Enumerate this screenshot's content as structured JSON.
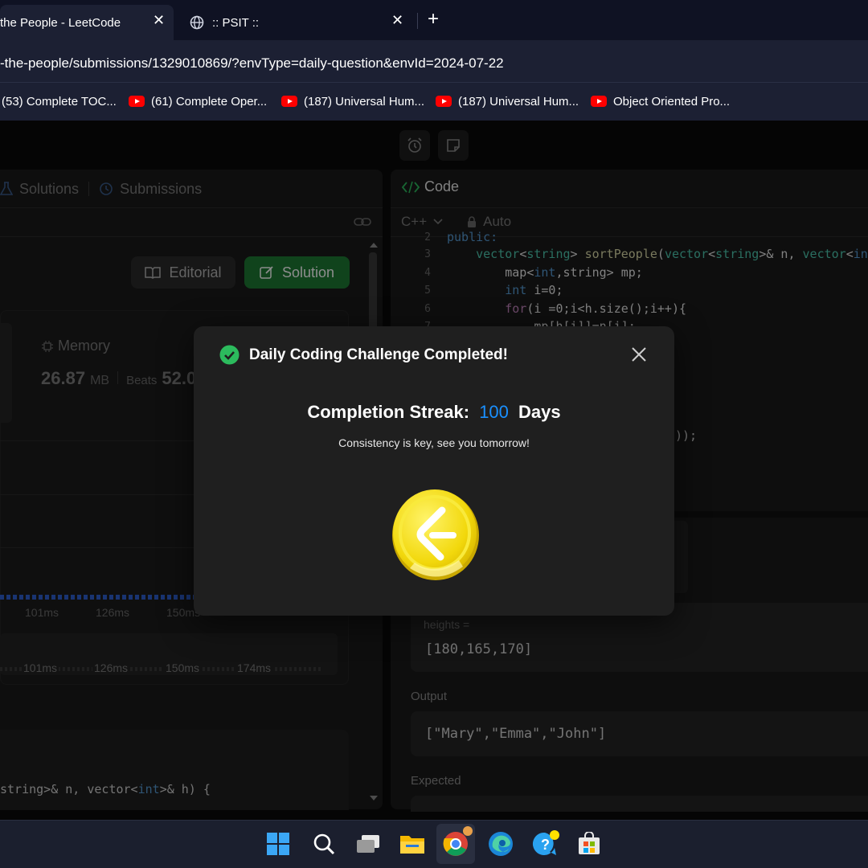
{
  "browser": {
    "tabs": [
      {
        "title": "the People - LeetCode",
        "active": true
      },
      {
        "title": ":: PSIT ::",
        "active": false
      }
    ],
    "new_tab_label": "+",
    "close_glyph": "✕",
    "url": "-the-people/submissions/1329010869/?envType=daily-question&envId=2024-07-22",
    "bookmarks": [
      {
        "label": "(53) Complete TOC..."
      },
      {
        "label": "(61) Complete Oper..."
      },
      {
        "label": "(187) Universal Hum..."
      },
      {
        "label": "(187) Universal Hum..."
      },
      {
        "label": "Object Oriented Pro..."
      }
    ]
  },
  "left_panel": {
    "tabs": [
      {
        "label": "Solutions"
      },
      {
        "label": "Submissions"
      }
    ],
    "editorial_label": "Editorial",
    "solution_label": "Solution",
    "memory": {
      "label": "Memory",
      "value": "26.87",
      "unit": "MB",
      "beats_label": "Beats",
      "beats_value": "52.0"
    },
    "runtime_axis": [
      "101ms",
      "126ms",
      "150ms"
    ],
    "runtime_axis_2": [
      "101ms",
      "126ms",
      "150ms",
      "174ms"
    ],
    "code_snippet": {
      "prefix": "string>& n, vector<",
      "kw": "int",
      "suffix": ">& h) {"
    }
  },
  "right_panel": {
    "title": "Code",
    "language": "C++",
    "auto_label": "Auto",
    "code_lines": [
      {
        "num": "2",
        "text": "public:"
      },
      {
        "num": "3",
        "text": "    vector<string> sortPeople(vector<string>& n, vector<int"
      },
      {
        "num": "4",
        "text": "        map<int,string> mp;"
      },
      {
        "num": "5",
        "text": "        int i=0;"
      },
      {
        "num": "6",
        "text": "        for(i =0;i<h.size();i++){"
      },
      {
        "num": "7",
        "text": "            mp[h[i]]=n[i];"
      }
    ],
    "code_tail": "));",
    "heights_label": "heights =",
    "heights_value": "[180,165,170]",
    "output_label": "Output",
    "output_value": "[\"Mary\",\"Emma\",\"John\"]",
    "expected_label": "Expected"
  },
  "modal": {
    "title": "Daily Coding Challenge Completed!",
    "streak_label": "Completion Streak:",
    "streak_value": "100",
    "streak_unit": "Days",
    "message": "Consistency is key, see you tomorrow!",
    "close_glyph": "✕",
    "colors": {
      "accent": "#1a90ff",
      "success": "#2cbb5d",
      "coin": "#f6e12b"
    }
  },
  "taskbar": {
    "icons": [
      "windows-start-icon",
      "search-icon",
      "task-view-icon",
      "file-explorer-icon",
      "chrome-icon",
      "edge-icon",
      "help-icon",
      "store-icon"
    ]
  }
}
